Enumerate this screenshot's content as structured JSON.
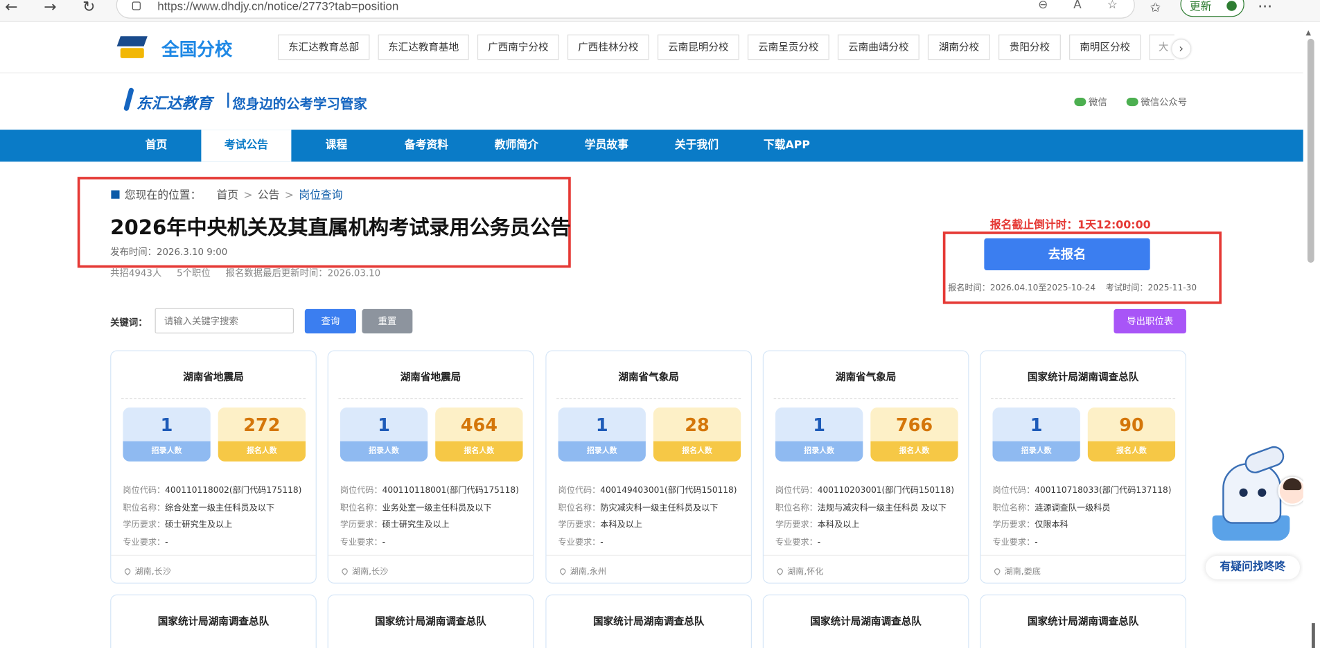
{
  "browser": {
    "url": "https://www.dhdjy.cn/notice/2773?tab=position",
    "update_label": "更新"
  },
  "branches": {
    "title": "全国分校",
    "tabs": [
      "东汇达教育总部",
      "东汇达教育基地",
      "广西南宁分校",
      "广西桂林分校",
      "云南昆明分校",
      "云南呈贡分校",
      "云南曲靖分校",
      "湖南分校",
      "贵阳分校",
      "南明区分校",
      "大"
    ]
  },
  "header": {
    "brand": "东汇达教育",
    "slogan": "您身边的公考学习管家",
    "wechat": "微信",
    "wechat_official": "微信公众号"
  },
  "nav": {
    "items": [
      "首页",
      "考试公告",
      "课程",
      "备考资料",
      "教师简介",
      "学员故事",
      "关于我们",
      "下载APP"
    ],
    "active_index": 1
  },
  "breadcrumb": {
    "prefix": "您现在的位置：",
    "home": "首页",
    "notice": "公告",
    "current": "岗位查询"
  },
  "notice": {
    "title": "2026年中央机关及其直属机构考试录用公务员公告",
    "publish_time": "发布时间：2026.3.10 9:00",
    "total": "共招4943人",
    "positions": "5个职位",
    "updated": "报名数据最后更新时间：2026.03.10"
  },
  "register": {
    "countdown": "报名截止倒计时：1天12:00:00",
    "button": "去报名",
    "reg_time": "报名时间：2026.04.10至2025-10-24",
    "exam_time": "考试时间：2025-11-30"
  },
  "search": {
    "label": "关键词：",
    "placeholder": "请输入关键字搜索",
    "query": "查询",
    "reset": "重置",
    "export": "导出职位表"
  },
  "card_labels": {
    "recruit": "招录人数",
    "applied": "报名人数",
    "code": "岗位代码：",
    "name": "职位名称：",
    "edu": "学历要求：",
    "major": "专业要求："
  },
  "cards": [
    {
      "dept": "湖南省地震局",
      "recruit": "1",
      "applied": "272",
      "code": "400110118002(部门代码175118)",
      "name": "综合处室一级主任科员及以下",
      "edu": "硕士研究生及以上",
      "major": "-",
      "location": "湖南,长沙"
    },
    {
      "dept": "湖南省地震局",
      "recruit": "1",
      "applied": "464",
      "code": "400110118001(部门代码175118)",
      "name": "业务处室一级主任科员及以下",
      "edu": "硕士研究生及以上",
      "major": "-",
      "location": "湖南,长沙"
    },
    {
      "dept": "湖南省气象局",
      "recruit": "1",
      "applied": "28",
      "code": "400149403001(部门代码150118)",
      "name": "防灾减灾科一级主任科员及以下",
      "edu": "本科及以上",
      "major": "-",
      "location": "湖南,永州"
    },
    {
      "dept": "湖南省气象局",
      "recruit": "1",
      "applied": "766",
      "code": "400110203001(部门代码150118)",
      "name": "法规与减灾科一级主任科员 及以下",
      "edu": "本科及以上",
      "major": "-",
      "location": "湖南,怀化"
    },
    {
      "dept": "国家统计局湖南调查总队",
      "recruit": "1",
      "applied": "90",
      "code": "400110718033(部门代码137118)",
      "name": "涟源调查队一级科员",
      "edu": "仅限本科",
      "major": "-",
      "location": "湖南,娄底"
    }
  ],
  "cards_row2": [
    "国家统计局湖南调查总队",
    "国家统计局湖南调查总队",
    "国家统计局湖南调查总队",
    "国家统计局湖南调查总队",
    "国家统计局湖南调查总队"
  ],
  "helper": {
    "label": "有疑问找咚咚"
  }
}
